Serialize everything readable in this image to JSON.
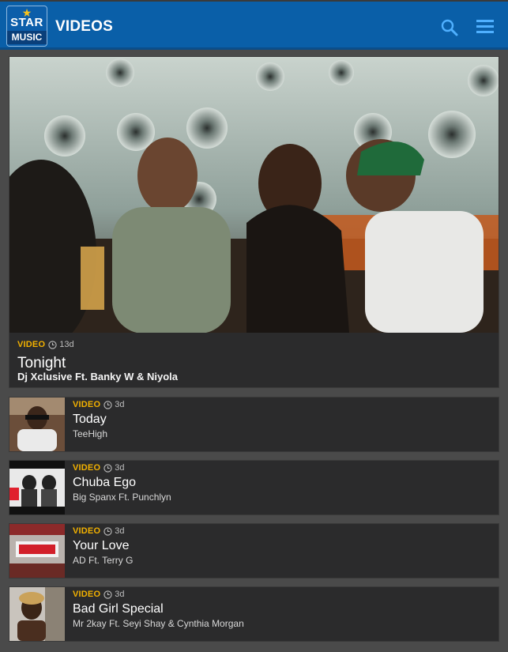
{
  "header": {
    "logo_top": "STAR",
    "logo_bottom": "MUSIC",
    "title": "VIDEOS",
    "search_icon": "search-icon",
    "menu_icon": "hamburger-menu-icon"
  },
  "colors": {
    "header_bg": "#0a5fa8",
    "tag": "#f2b100",
    "card_bg": "#2b2b2c",
    "page_bg": "#4a4a4a"
  },
  "featured": {
    "tag": "VIDEO",
    "age": "13d",
    "title": "Tonight",
    "artist": "Dj Xclusive Ft. Banky W & Niyola"
  },
  "items": [
    {
      "tag": "VIDEO",
      "age": "3d",
      "title": "Today",
      "artist": "TeeHigh"
    },
    {
      "tag": "VIDEO",
      "age": "3d",
      "title": "Chuba Ego",
      "artist": "Big Spanx Ft. Punchlyn"
    },
    {
      "tag": "VIDEO",
      "age": "3d",
      "title": "Your Love",
      "artist": "AD Ft. Terry G"
    },
    {
      "tag": "VIDEO",
      "age": "3d",
      "title": "Bad Girl Special",
      "artist": "Mr 2kay Ft. Seyi Shay & Cynthia Morgan"
    }
  ]
}
